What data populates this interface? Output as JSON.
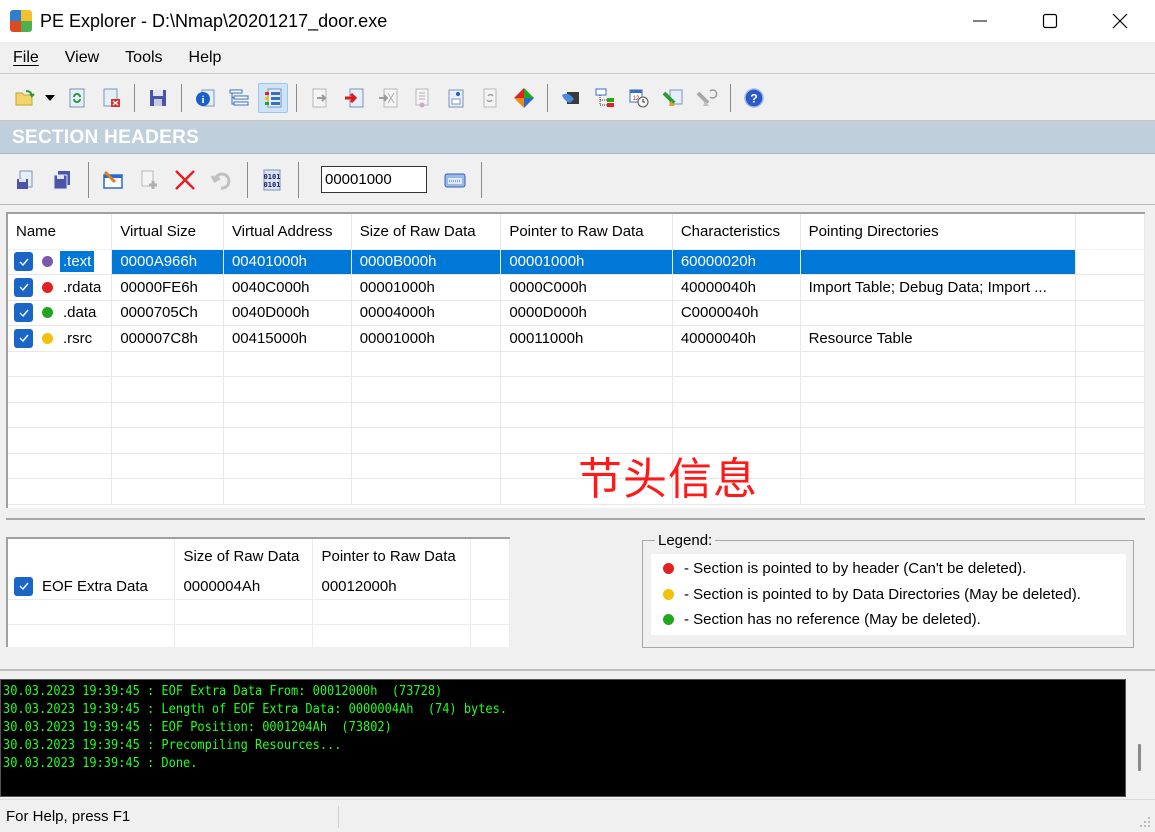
{
  "window": {
    "title": "PE Explorer - D:\\Nmap\\20201217_door.exe",
    "app_icon": "pe-explorer-logo-icon",
    "controls": [
      "minimize-icon",
      "maximize-icon",
      "close-icon"
    ]
  },
  "menu": {
    "items": [
      {
        "label": "File",
        "accel": "F"
      },
      {
        "label": "View",
        "accel": "V"
      },
      {
        "label": "Tools",
        "accel": "T"
      },
      {
        "label": "Help",
        "accel": "H"
      }
    ]
  },
  "toolbar": {
    "buttons": [
      "open-folder-icon",
      "dropdown-arrow-icon",
      "reload-icon",
      "close-file-icon",
      "save-icon",
      "info-icon",
      "headers-tree-icon",
      "section-headers-icon",
      "export-icon",
      "import-icon",
      "resource-editor-icon",
      "certificate-icon",
      "properties-icon",
      "sync-icon",
      "color-diamond-icon",
      "disassembler-icon",
      "dependency-scanner-icon",
      "date-time-icon",
      "cleaner-icon",
      "undo-cleaner-icon",
      "help-icon"
    ],
    "active": "section-headers-icon"
  },
  "section": {
    "title": "SECTION HEADERS"
  },
  "toolbar2": {
    "buttons": [
      "extract-section-icon",
      "save-section-icon",
      "edit-section-icon",
      "add-section-icon",
      "delete-section-icon",
      "undo-icon",
      "binary-view-icon",
      "calculator-icon"
    ],
    "address_value": "00001000"
  },
  "sections_table": {
    "columns": [
      "Name",
      "Virtual Size",
      "Virtual Address",
      "Size of Raw Data",
      "Pointer to Raw Data",
      "Characteristics",
      "Pointing Directories"
    ],
    "rows": [
      {
        "name": ".text",
        "checked": true,
        "dot": "#7a5aa8",
        "virtual_size": "0000A966h",
        "virtual_address": "00401000h",
        "size_raw": "0000B000h",
        "ptr_raw": "00001000h",
        "characteristics": "60000020h",
        "pointing": "",
        "selected": true
      },
      {
        "name": ".rdata",
        "checked": true,
        "dot": "#e52020",
        "virtual_size": "00000FE6h",
        "virtual_address": "0040C000h",
        "size_raw": "00001000h",
        "ptr_raw": "0000C000h",
        "characteristics": "40000040h",
        "pointing": "Import Table; Debug Data; Import ...",
        "selected": false
      },
      {
        "name": ".data",
        "checked": true,
        "dot": "#1fa81f",
        "virtual_size": "0000705Ch",
        "virtual_address": "0040D000h",
        "size_raw": "00004000h",
        "ptr_raw": "0000D000h",
        "characteristics": "C0000040h",
        "pointing": "",
        "selected": false
      },
      {
        "name": ".rsrc",
        "checked": true,
        "dot": "#f2c00d",
        "virtual_size": "000007C8h",
        "virtual_address": "00415000h",
        "size_raw": "00001000h",
        "ptr_raw": "00011000h",
        "characteristics": "40000040h",
        "pointing": "Resource Table",
        "selected": false
      }
    ]
  },
  "annotation": "节头信息",
  "eof_table": {
    "columns": [
      "",
      "Size of Raw Data",
      "Pointer to Raw Data",
      ""
    ],
    "rows": [
      {
        "name": "EOF Extra Data",
        "checked": true,
        "size_raw": "0000004Ah",
        "ptr_raw": "00012000h"
      }
    ]
  },
  "legend": {
    "title": "Legend:",
    "items": [
      {
        "color": "#e52020",
        "text": "- Section is pointed to by header (Can't be deleted)."
      },
      {
        "color": "#f2c00d",
        "text": "- Section is pointed to by Data Directories (May be deleted)."
      },
      {
        "color": "#1fa81f",
        "text": "- Section has no reference (May be deleted)."
      }
    ]
  },
  "log": {
    "lines": [
      "30.03.2023 19:39:45 : EOF Extra Data From: 00012000h  (73728)",
      "30.03.2023 19:39:45 : Length of EOF Extra Data: 0000004Ah  (74) bytes.",
      "30.03.2023 19:39:45 : EOF Position: 0001204Ah  (73802)",
      "30.03.2023 19:39:45 : Precompiling Resources...",
      "30.03.2023 19:39:45 : Done."
    ]
  },
  "status": {
    "text": "For Help, press F1"
  }
}
